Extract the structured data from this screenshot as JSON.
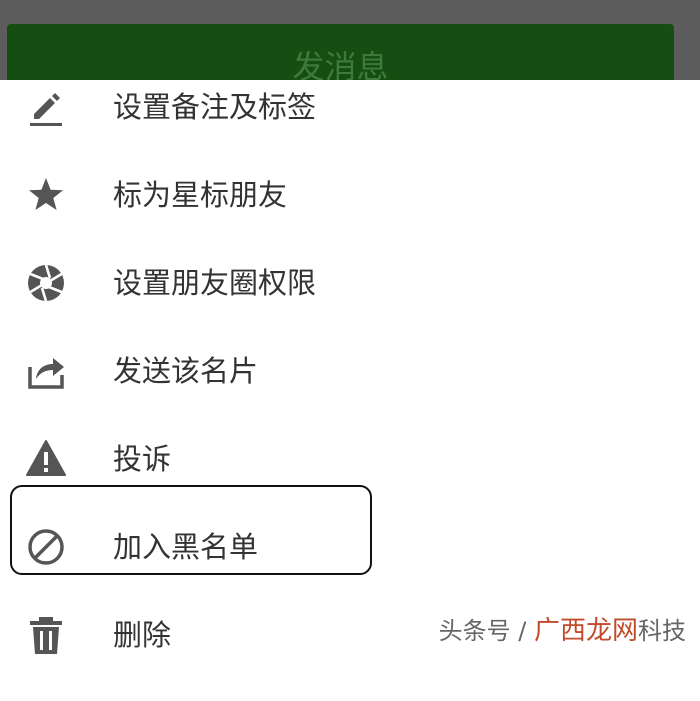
{
  "header": {
    "send_message_label": "发消息"
  },
  "menu": {
    "items": [
      {
        "label": "设置备注及标签",
        "icon": "edit-pencil-icon"
      },
      {
        "label": "标为星标朋友",
        "icon": "star-icon"
      },
      {
        "label": "设置朋友圈权限",
        "icon": "aperture-icon"
      },
      {
        "label": "发送该名片",
        "icon": "share-icon"
      },
      {
        "label": "投诉",
        "icon": "warning-icon"
      },
      {
        "label": "加入黑名单",
        "icon": "block-icon"
      },
      {
        "label": "删除",
        "icon": "trash-icon"
      }
    ]
  },
  "watermark": {
    "prefix": "头条号 / ",
    "brand": "广西龙网",
    "suffix": "科技"
  },
  "colors": {
    "button_bg": "#154d12",
    "icon_gray": "#555555",
    "text": "#333333",
    "highlight_border": "#111111"
  }
}
